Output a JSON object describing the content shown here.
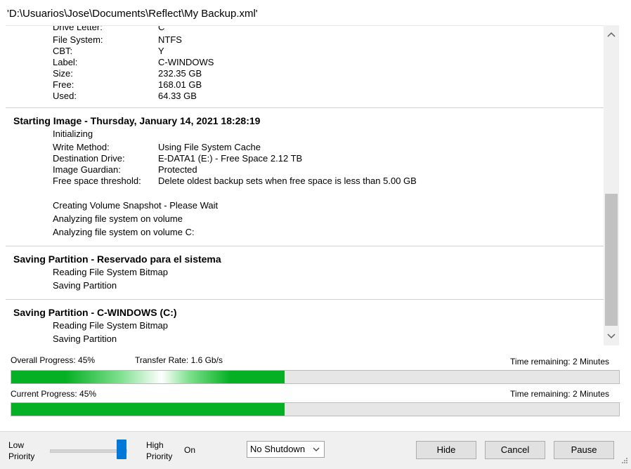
{
  "window": {
    "title": "'D:\\Usuarios\\Jose\\Documents\\Reflect\\My Backup.xml'"
  },
  "log": {
    "volume_info": [
      {
        "key": "Drive Letter:",
        "value": "C"
      },
      {
        "key": "File System:",
        "value": "NTFS"
      },
      {
        "key": "CBT:",
        "value": "Y"
      },
      {
        "key": "Label:",
        "value": "C-WINDOWS"
      },
      {
        "key": "Size:",
        "value": "232.35 GB"
      },
      {
        "key": "Free:",
        "value": "168.01 GB"
      },
      {
        "key": "Used:",
        "value": "64.33 GB"
      }
    ],
    "starting_image": {
      "heading": "Starting Image - Thursday, January 14, 2021 18:28:19",
      "status": "Initializing",
      "details": [
        {
          "key": "Write Method:",
          "value": "Using File System Cache"
        },
        {
          "key": "Destination Drive:",
          "value": "E-DATA1 (E:) - Free Space 2.12 TB"
        },
        {
          "key": "Image Guardian:",
          "value": "Protected"
        },
        {
          "key": "Free space threshold:",
          "value": "Delete oldest backup sets when free space is less than 5.00 GB"
        }
      ],
      "steps": [
        "Creating Volume Snapshot - Please Wait",
        "Analyzing file system on volume",
        "Analyzing file system on volume C:"
      ]
    },
    "partition_reserved": {
      "heading": "Saving Partition - Reservado para el sistema",
      "steps": [
        "Reading File System Bitmap",
        "Saving Partition"
      ]
    },
    "partition_windows": {
      "heading": "Saving Partition - C-WINDOWS (C:)",
      "steps": [
        "Reading File System Bitmap",
        "Saving Partition"
      ]
    }
  },
  "overall": {
    "label": "Overall Progress:  45%",
    "transfer": "Transfer Rate: 1.6 Gb/s",
    "remaining": "Time remaining: 2 Minutes",
    "percent": 45
  },
  "current": {
    "label": "Current Progress:  45%",
    "remaining": "Time remaining: 2 Minutes",
    "percent": 45
  },
  "footer": {
    "priority_low": "Low\nPriority",
    "priority_high": "High\nPriority",
    "priority_value": 1.0,
    "on_label": "On",
    "shutdown_select": "No Shutdown",
    "hide_button": "Hide",
    "cancel_button": "Cancel",
    "pause_button": "Pause"
  },
  "colors": {
    "progress_fill": "#06b025",
    "slider_thumb": "#0078d7"
  },
  "icons": {
    "scroll_up": "chevron-up-icon",
    "scroll_down": "chevron-down-icon",
    "dropdown": "chevron-down-icon",
    "resize_grip": "resize-grip-icon"
  }
}
